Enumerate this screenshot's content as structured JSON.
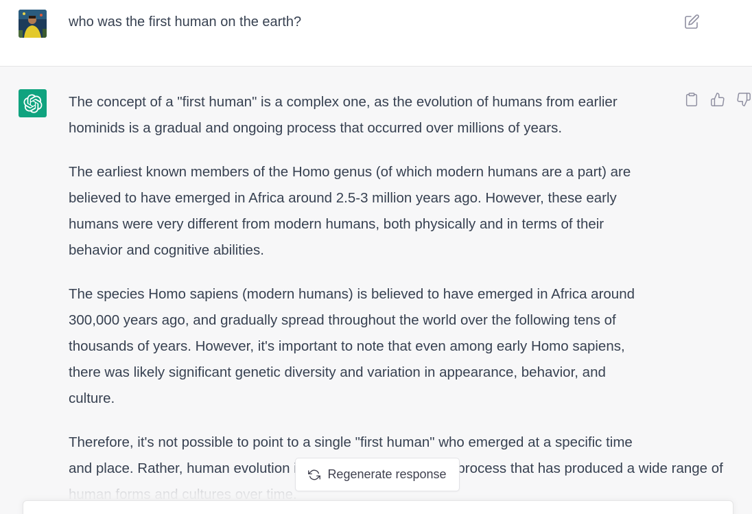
{
  "user_message": {
    "text": "who was the first human on the earth?",
    "edit_icon": "edit-icon"
  },
  "assistant_message": {
    "avatar_icon": "openai-logo-icon",
    "paragraphs": [
      [
        "The concept of a \"first human\" is a complex one, as the evolution of humans from earlier",
        "hominids is a gradual and ongoing process that occurred over millions of years."
      ],
      [
        "The earliest known members of the Homo genus (of which modern humans are a part) are",
        "believed to have emerged in Africa around 2.5-3 million years ago. However, these early",
        "humans were very different from modern humans, both physically and in terms of their",
        "behavior and cognitive abilities."
      ],
      [
        "The species Homo sapiens (modern humans) is believed to have emerged in Africa around",
        "300,000 years ago, and gradually spread throughout the world over the following tens of",
        "thousands of years. However, it's important to note that even among early Homo sapiens,",
        "there was likely significant genetic diversity and variation in appearance, behavior, and",
        "culture."
      ],
      [
        "Therefore, it's not possible to point to a single \"first human\" who emerged at a specific time",
        "and place. Rather, human evolution is a complex and ongoing process that has produced a wide range of",
        "human forms and cultures over time."
      ]
    ],
    "actions": {
      "copy_icon": "clipboard-icon",
      "like_icon": "thumbs-up-icon",
      "dislike_icon": "thumbs-down-icon"
    }
  },
  "regenerate": {
    "label": "Regenerate response",
    "icon": "refresh-icon"
  },
  "colors": {
    "assistant_bg": "#f7f7f8",
    "brand_green": "#10a37f",
    "text": "#374151"
  }
}
